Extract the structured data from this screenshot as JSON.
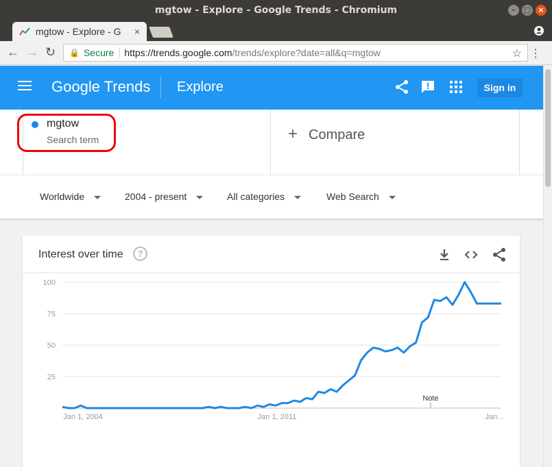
{
  "window": {
    "title": "mgtow - Explore - Google Trends - Chromium"
  },
  "tab": {
    "title": "mgtow - Explore - G",
    "close": "×"
  },
  "toolbar": {
    "back": "←",
    "forward": "→",
    "reload": "↻",
    "secure_label": "Secure",
    "url_host": "https://trends.google.com",
    "url_rest": "/trends/explore?date=all&q=mgtow",
    "star": "☆",
    "menu": "⋮"
  },
  "header": {
    "logo_google": "Google",
    "logo_trends": "Trends",
    "section": "Explore",
    "signin_label": "Sign in"
  },
  "search": {
    "term": "mgtow",
    "term_sub": "Search term",
    "compare_plus": "+",
    "compare_label": "Compare"
  },
  "filters": [
    {
      "label": "Worldwide"
    },
    {
      "label": "2004 - present"
    },
    {
      "label": "All categories"
    },
    {
      "label": "Web Search"
    }
  ],
  "card": {
    "title": "Interest over time",
    "help": "?"
  },
  "colors": {
    "header": "#2196f3",
    "series": "#1e88e5",
    "highlight": "#e00000"
  },
  "icons": [
    "share-icon",
    "feedback-icon",
    "apps-grid-icon",
    "download-icon",
    "embed-icon",
    "menu-icon",
    "lock-icon",
    "star-icon"
  ],
  "chart_data": {
    "type": "line",
    "title": "",
    "xlabel": "",
    "ylabel": "",
    "ylim": [
      0,
      100
    ],
    "yticks": [
      "100",
      "75",
      "50",
      "25"
    ],
    "xticks": [
      "Jan 1, 2004",
      "Jan 1, 2011",
      "Jan..."
    ],
    "annotation": "Note",
    "grid": true,
    "series": [
      {
        "x": [
          "2004-01",
          "2004-04",
          "2004-07",
          "2004-10",
          "2005-01",
          "2005-04",
          "2005-07",
          "2005-10",
          "2006-01",
          "2006-04",
          "2006-07",
          "2006-10",
          "2007-01",
          "2007-04",
          "2007-07",
          "2007-10",
          "2008-01",
          "2008-04",
          "2008-07",
          "2008-10",
          "2009-01",
          "2009-04",
          "2009-07",
          "2009-10",
          "2010-01",
          "2010-04",
          "2010-07",
          "2010-10",
          "2011-01",
          "2011-04",
          "2011-07",
          "2011-10",
          "2012-01",
          "2012-04",
          "2012-07",
          "2012-10",
          "2013-01",
          "2013-04",
          "2013-07",
          "2013-10",
          "2014-01",
          "2014-04",
          "2014-07",
          "2014-10",
          "2015-01",
          "2015-04",
          "2015-07",
          "2015-10",
          "2016-01",
          "2016-04",
          "2016-07",
          "2016-10",
          "2017-01",
          "2017-04",
          "2017-07",
          "2017-10",
          "2018-01",
          "2018-04",
          "2018-07",
          "2018-10",
          "2019-01",
          "2019-04",
          "2019-07",
          "2019-10",
          "2020-01",
          "2020-04",
          "2020-07",
          "2020-10",
          "2021-01",
          "2021-04",
          "2021-07",
          "2021-10",
          "2022-01"
        ],
        "values": [
          1,
          0,
          0,
          2,
          0,
          0,
          0,
          0,
          0,
          0,
          0,
          0,
          0,
          0,
          0,
          0,
          0,
          0,
          0,
          0,
          0,
          0,
          0,
          0,
          1,
          0,
          1,
          0,
          0,
          0,
          1,
          0,
          2,
          1,
          3,
          2,
          4,
          4,
          6,
          5,
          8,
          7,
          13,
          12,
          15,
          13,
          18,
          22,
          26,
          38,
          44,
          48,
          47,
          45,
          46,
          48,
          44,
          49,
          52,
          68,
          72,
          86,
          85,
          88,
          82,
          90,
          100,
          92,
          83,
          83,
          83,
          83,
          83
        ]
      }
    ]
  }
}
